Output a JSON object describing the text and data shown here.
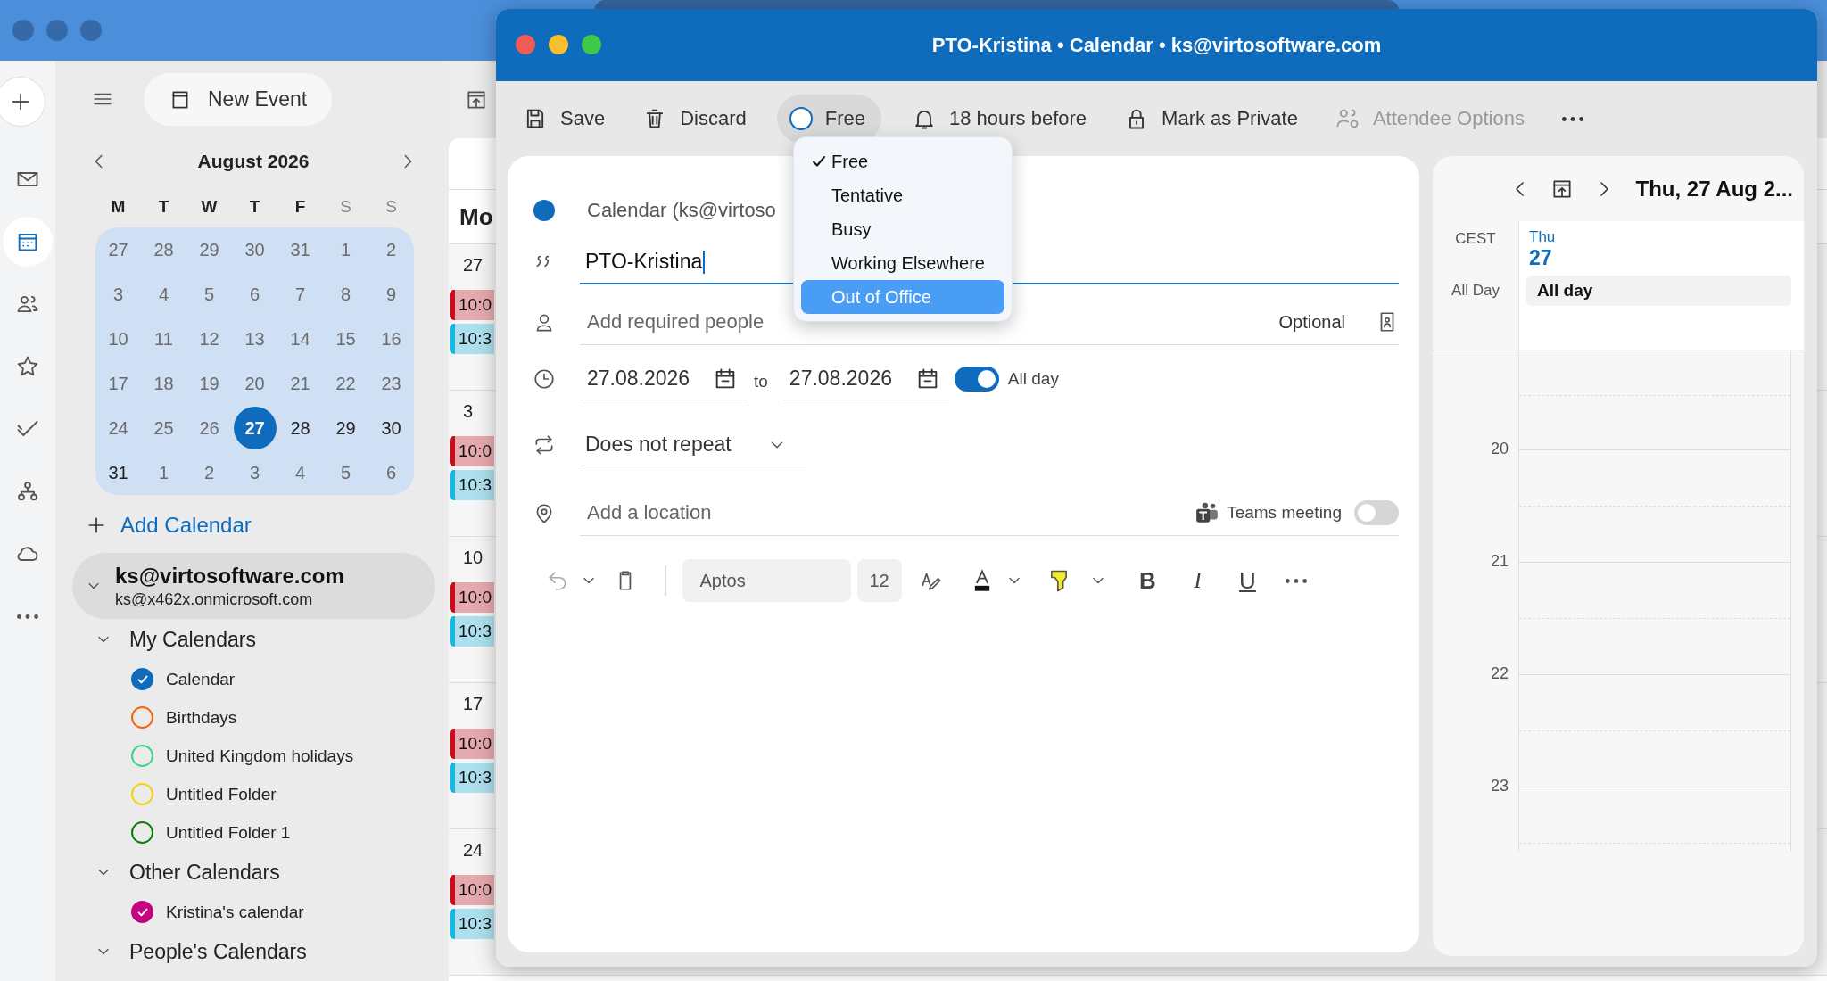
{
  "app": {
    "rail": [
      {
        "kind": "new",
        "selected": false
      },
      {
        "kind": "mail",
        "selected": false
      },
      {
        "kind": "calendar",
        "selected": true
      },
      {
        "kind": "people",
        "selected": false
      },
      {
        "kind": "star",
        "selected": false
      },
      {
        "kind": "todo",
        "selected": false
      },
      {
        "kind": "org",
        "selected": false
      },
      {
        "kind": "cloud",
        "selected": false
      },
      {
        "kind": "more",
        "selected": false
      }
    ],
    "new_event": "New Event",
    "mini_calendar": {
      "month": "August 2026",
      "weekdays": [
        "M",
        "T",
        "W",
        "T",
        "F",
        "S",
        "S"
      ],
      "weeks": [
        [
          {
            "day": "27",
            "muted": true,
            "selected": false
          },
          {
            "day": "28",
            "muted": true,
            "selected": false
          },
          {
            "day": "29",
            "muted": true,
            "selected": false
          },
          {
            "day": "30",
            "muted": true,
            "selected": false
          },
          {
            "day": "31",
            "muted": true,
            "selected": false
          },
          {
            "day": "1",
            "muted": true,
            "selected": false
          },
          {
            "day": "2",
            "muted": true,
            "selected": false
          }
        ],
        [
          {
            "day": "3",
            "muted": true,
            "selected": false
          },
          {
            "day": "4",
            "muted": true,
            "selected": false
          },
          {
            "day": "5",
            "muted": true,
            "selected": false
          },
          {
            "day": "6",
            "muted": true,
            "selected": false
          },
          {
            "day": "7",
            "muted": true,
            "selected": false
          },
          {
            "day": "8",
            "muted": true,
            "selected": false
          },
          {
            "day": "9",
            "muted": true,
            "selected": false
          }
        ],
        [
          {
            "day": "10",
            "muted": true,
            "selected": false
          },
          {
            "day": "11",
            "muted": true,
            "selected": false
          },
          {
            "day": "12",
            "muted": true,
            "selected": false
          },
          {
            "day": "13",
            "muted": true,
            "selected": false
          },
          {
            "day": "14",
            "muted": true,
            "selected": false
          },
          {
            "day": "15",
            "muted": true,
            "selected": false
          },
          {
            "day": "16",
            "muted": true,
            "selected": false
          }
        ],
        [
          {
            "day": "17",
            "muted": true,
            "selected": false
          },
          {
            "day": "18",
            "muted": true,
            "selected": false
          },
          {
            "day": "19",
            "muted": true,
            "selected": false
          },
          {
            "day": "20",
            "muted": true,
            "selected": false
          },
          {
            "day": "21",
            "muted": true,
            "selected": false
          },
          {
            "day": "22",
            "muted": true,
            "selected": false
          },
          {
            "day": "23",
            "muted": true,
            "selected": false
          }
        ],
        [
          {
            "day": "24",
            "muted": true,
            "selected": false
          },
          {
            "day": "25",
            "muted": true,
            "selected": false
          },
          {
            "day": "26",
            "muted": true,
            "selected": false
          },
          {
            "day": "27",
            "muted": false,
            "selected": true
          },
          {
            "day": "28",
            "muted": false,
            "selected": false
          },
          {
            "day": "29",
            "muted": false,
            "selected": false
          },
          {
            "day": "30",
            "muted": false,
            "selected": false
          }
        ],
        [
          {
            "day": "31",
            "muted": false,
            "selected": false
          },
          {
            "day": "1",
            "muted": true,
            "selected": false
          },
          {
            "day": "2",
            "muted": true,
            "selected": false
          },
          {
            "day": "3",
            "muted": true,
            "selected": false
          },
          {
            "day": "4",
            "muted": true,
            "selected": false
          },
          {
            "day": "5",
            "muted": true,
            "selected": false
          },
          {
            "day": "6",
            "muted": true,
            "selected": false
          }
        ]
      ]
    },
    "add_calendar": "Add Calendar",
    "account": {
      "name": "ks@virtosoftware.com",
      "email": "ks@x462x.onmicrosoft.com",
      "expanded": true
    },
    "groups": [
      {
        "name": "My Calendars",
        "expanded": true,
        "calendars": [
          {
            "name": "Calendar",
            "color": "#0f6cbd",
            "checked": true
          },
          {
            "name": "Birthdays",
            "color": "#f7630c",
            "checked": false
          },
          {
            "name": "United Kingdom holidays",
            "color": "#3fd08e",
            "checked": false
          },
          {
            "name": "Untitled Folder",
            "color": "#f2d20a",
            "checked": false
          },
          {
            "name": "Untitled Folder 1",
            "color": "#107c10",
            "checked": false
          }
        ]
      },
      {
        "name": "Other Calendars",
        "expanded": true,
        "calendars": [
          {
            "name": "Kristina's calendar",
            "color": "#c3057f",
            "checked": true
          }
        ]
      },
      {
        "name": "People's Calendars",
        "expanded": true
      }
    ],
    "week_view": {
      "header": "Mo",
      "weeks": [
        {
          "number": "27",
          "events": [
            {
              "time": "10:0",
              "color": "#c50f1f"
            },
            {
              "time": "10:3",
              "color": "#1cb5e0"
            }
          ]
        },
        {
          "number": "3",
          "events": [
            {
              "time": "10:0",
              "color": "#c50f1f"
            },
            {
              "time": "10:3",
              "color": "#1cb5e0"
            }
          ]
        },
        {
          "number": "10",
          "events": [
            {
              "time": "10:0",
              "color": "#c50f1f"
            },
            {
              "time": "10:3",
              "color": "#1cb5e0"
            }
          ]
        },
        {
          "number": "17",
          "events": [
            {
              "time": "10:0",
              "color": "#c50f1f"
            },
            {
              "time": "10:3",
              "color": "#1cb5e0"
            }
          ]
        },
        {
          "number": "24",
          "events": [
            {
              "time": "10:0",
              "color": "#c50f1f"
            },
            {
              "time": "10:3",
              "color": "#1cb5e0"
            }
          ]
        }
      ]
    }
  },
  "dialog": {
    "title": "PTO-Kristina • Calendar • ks@virtosoftware.com",
    "toolbar": [
      {
        "kind": "save",
        "label": "Save",
        "disabled": false
      },
      {
        "kind": "discard",
        "label": "Discard",
        "disabled": false
      },
      {
        "kind": "show_as",
        "label": "Free",
        "disabled": false
      },
      {
        "kind": "reminder",
        "label": "18 hours before",
        "disabled": false
      },
      {
        "kind": "private",
        "label": "Mark as Private",
        "disabled": false
      },
      {
        "kind": "attendees",
        "label": "Attendee Options",
        "disabled": true
      }
    ],
    "show_as_menu": {
      "open": true,
      "items": [
        {
          "label": "Free",
          "checked": true,
          "selected": false
        },
        {
          "label": "Tentative",
          "checked": false,
          "selected": false
        },
        {
          "label": "Busy",
          "checked": false,
          "selected": false
        },
        {
          "label": "Working Elsewhere",
          "checked": false,
          "selected": false
        },
        {
          "label": "Out of Office",
          "checked": false,
          "selected": true
        }
      ]
    },
    "calendar": {
      "label": "Calendar (ks@virtoso",
      "color": "#0f6cbd"
    },
    "title_field": {
      "value": "PTO-Kristina"
    },
    "people": {
      "placeholder": "Add required people",
      "optional": "Optional"
    },
    "start_date": "27.08.2026",
    "to": "to",
    "end_date": "27.08.2026",
    "all_day": {
      "label": "All day",
      "on": true
    },
    "repeat": "Does not repeat",
    "location": {
      "placeholder": "Add a location"
    },
    "teams": {
      "label": "Teams meeting",
      "on": false
    },
    "format": {
      "font": "Aptos",
      "size": "12",
      "styles": [
        {
          "kind": "bold",
          "glyph": "B"
        },
        {
          "kind": "italic",
          "glyph": "I"
        },
        {
          "kind": "underline",
          "glyph": "U"
        }
      ]
    },
    "day_view": {
      "title": "Thu, 27 Aug 2...",
      "timezone": "CEST",
      "weekday": "Thu",
      "date": "27",
      "all_day_label": "All Day",
      "events": [
        {
          "title": "All day"
        }
      ],
      "hours": [
        "20",
        "21",
        "22",
        "23"
      ]
    }
  }
}
